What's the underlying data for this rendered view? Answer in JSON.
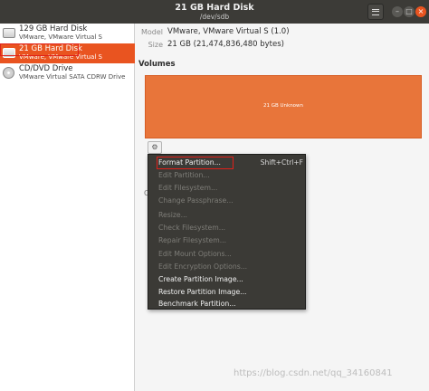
{
  "window": {
    "title": "21 GB Hard Disk",
    "subtitle": "/dev/sdb",
    "controls": {
      "minimize": "–",
      "maximize": "□",
      "close": "×"
    }
  },
  "sidebar": {
    "disks": [
      {
        "name": "129 GB Hard Disk",
        "sub": "VMware, VMware Virtual S",
        "icon": "hard-disk-icon",
        "selected": false
      },
      {
        "name": "21 GB Hard Disk",
        "sub": "VMware, VMware Virtual S",
        "icon": "hard-disk-icon",
        "selected": true
      },
      {
        "name": "CD/DVD Drive",
        "sub": "VMware Virtual SATA CDRW Drive",
        "icon": "optical-drive-icon",
        "selected": false
      }
    ]
  },
  "details": {
    "model_label": "Model",
    "model_value": "VMware, VMware Virtual S (1.0)",
    "size_label": "Size",
    "size_value": "21 GB (21,474,836,480 bytes)"
  },
  "volumes": {
    "heading": "Volumes",
    "partition_label": "21 GB Unknown",
    "partition_color": "#e8753a",
    "gear_icon": "gear-icon"
  },
  "context_menu": {
    "items": [
      {
        "label": "Format Partition...",
        "accel": "Shift+Ctrl+F",
        "enabled": true
      },
      {
        "label": "Edit Partition...",
        "accel": "",
        "enabled": false
      },
      {
        "label": "Edit Filesystem...",
        "accel": "",
        "enabled": false
      },
      {
        "label": "Change Passphrase...",
        "accel": "",
        "enabled": false
      },
      {
        "label": "Resize...",
        "accel": "",
        "enabled": false
      },
      {
        "label": "Check Filesystem...",
        "accel": "",
        "enabled": false
      },
      {
        "label": "Repair Filesystem...",
        "accel": "",
        "enabled": false
      },
      {
        "label": "Edit Mount Options...",
        "accel": "",
        "enabled": false
      },
      {
        "label": "Edit Encryption Options...",
        "accel": "",
        "enabled": false
      },
      {
        "label": "Create Partition Image...",
        "accel": "",
        "enabled": true
      },
      {
        "label": "Restore Partition Image...",
        "accel": "",
        "enabled": true
      },
      {
        "label": "Benchmark Partition...",
        "accel": "",
        "enabled": true
      }
    ]
  },
  "watermark": "https://blog.csdn.net/qq_34160841",
  "colors": {
    "accent": "#e95420",
    "titlebar": "#3c3b37",
    "menu_bg": "#3b3a36"
  }
}
